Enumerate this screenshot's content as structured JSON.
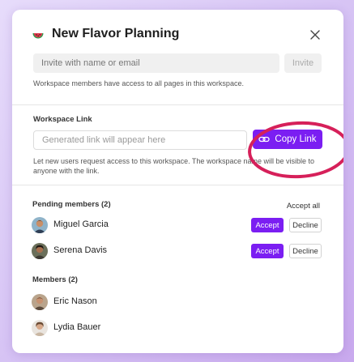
{
  "header": {
    "title": "New Flavor Planning",
    "icon": "watermelon-icon"
  },
  "invite": {
    "placeholder": "Invite with name or email",
    "button_label": "Invite",
    "helper_text": "Workspace members have access to all pages in this workspace."
  },
  "workspace_link": {
    "label": "Workspace Link",
    "placeholder": "Generated link will appear here",
    "copy_button_label": "Copy Link",
    "helper_text": "Let new users request access to this workspace. The workspace name will be visible to anyone with the link."
  },
  "pending": {
    "label": "Pending members (2)",
    "accept_all_label": "Accept all",
    "accept_label": "Accept",
    "decline_label": "Decline",
    "items": [
      {
        "name": "Miguel Garcia"
      },
      {
        "name": "Serena Davis"
      }
    ]
  },
  "members": {
    "label": "Members (2)",
    "items": [
      {
        "name": "Eric Nason"
      },
      {
        "name": "Lydia Bauer"
      }
    ]
  },
  "colors": {
    "accent": "#7b1ef2",
    "highlight_ring": "#d6205a"
  }
}
